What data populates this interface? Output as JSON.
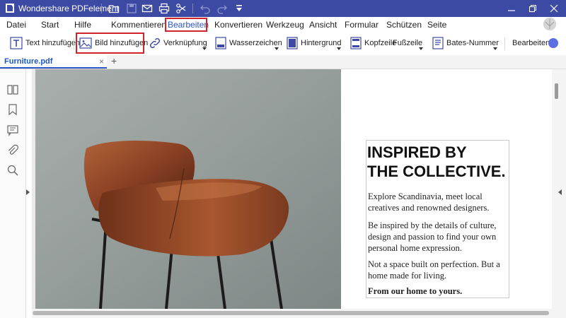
{
  "app": {
    "title": "Wondershare PDFelement"
  },
  "menu": {
    "items": [
      "Datei",
      "Start",
      "Hilfe",
      "Kommentieren",
      "Bearbeiten",
      "Konvertieren",
      "Werkzeug",
      "Ansicht",
      "Formular",
      "Schützen",
      "Seite"
    ],
    "active": "Bearbeiten"
  },
  "toolbar": {
    "text_add": "Text hinzufügen",
    "image_add": "Bild hinzufügen",
    "link": "Verknüpfung",
    "watermark": "Wasserzeichen",
    "background": "Hintergrund",
    "header": "Kopfzeile",
    "footer": "Fußzeile",
    "bates": "Bates-Nummer",
    "edit": "Bearbeiten"
  },
  "tabs": {
    "document": "Furniture.pdf",
    "close": "×",
    "add": "+"
  },
  "document": {
    "headline_line1": "INSPIRED BY",
    "headline_line2": "THE COLLECTIVE.",
    "para1": "Explore Scandinavia, meet local creatives and renowned designers.",
    "para2": "Be inspired by the details of culture, design and passion to find your own personal home expression.",
    "para3": "Not a space built on perfection. But a home made for living.",
    "para4": "From our home to yours."
  },
  "colors": {
    "titlebar": "#3c4aa3",
    "accent": "#2f56c9",
    "highlight": "#d0242d"
  },
  "icons": [
    "pdfelement-logo-icon",
    "folder-icon",
    "save-icon",
    "mail-icon",
    "print-icon",
    "scissors-icon",
    "undo-icon",
    "redo-icon",
    "dropdown-icon",
    "minimize-icon",
    "maximize-icon",
    "close-icon",
    "thumbnails-icon",
    "bookmark-icon",
    "comment-icon",
    "attachment-icon",
    "search-icon"
  ]
}
